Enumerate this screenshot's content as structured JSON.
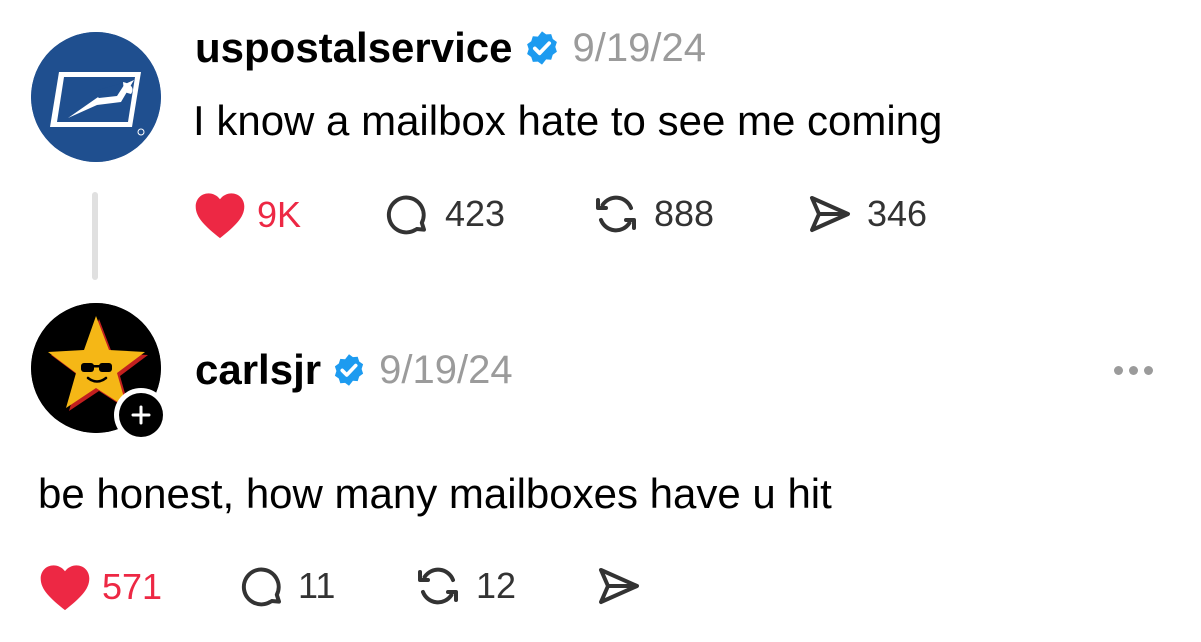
{
  "colors": {
    "like": "#ed2844",
    "verified": "#1d9bf0",
    "secondary_text": "#9b9b9b",
    "usps_blue": "#1f4f8f",
    "carls_star": "#f5b716"
  },
  "posts": [
    {
      "username": "uspostalservice",
      "verified": true,
      "date": "9/19/24",
      "text": "I know a mailbox hate to see me coming",
      "avatar_icon": "usps-eagle-logo",
      "liked": true,
      "likes": "9K",
      "replies": "423",
      "reposts": "888",
      "shares": "346"
    },
    {
      "username": "carlsjr",
      "verified": true,
      "date": "9/19/24",
      "text": "be honest, how many mailboxes have u hit",
      "avatar_icon": "carls-jr-star-logo",
      "follow_icon": "plus-icon",
      "liked": true,
      "likes": "571",
      "replies": "11",
      "reposts": "12",
      "shares": ""
    }
  ]
}
